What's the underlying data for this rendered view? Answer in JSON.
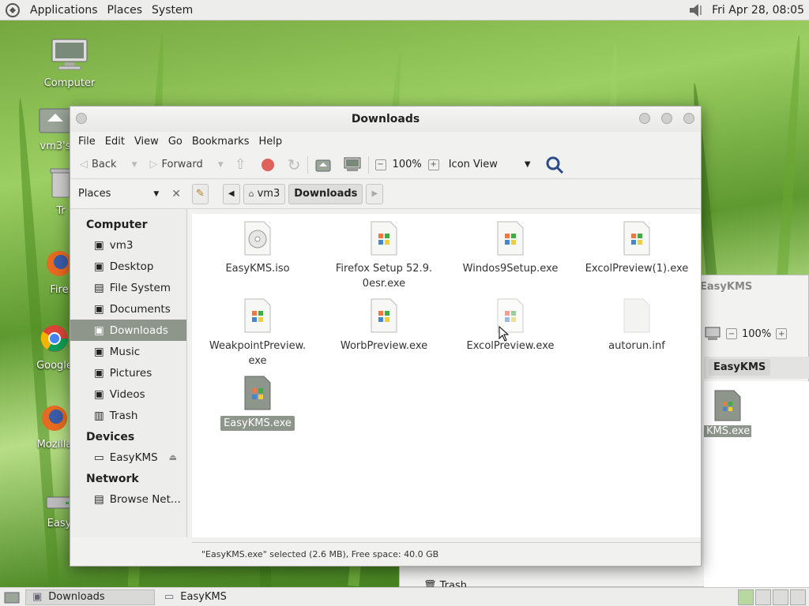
{
  "top_panel": {
    "menus": [
      "Applications",
      "Places",
      "System"
    ],
    "clock": "Fri Apr 28, 08:05"
  },
  "desktop_icons": [
    {
      "label": "Computer",
      "icon": "computer-icon"
    },
    {
      "label": "vm3's",
      "icon": "home-folder-icon"
    },
    {
      "label": "Tr",
      "icon": "trash-icon"
    },
    {
      "label": "Fire",
      "icon": "firefox-icon"
    },
    {
      "label": "Google",
      "icon": "chrome-icon"
    },
    {
      "label": "Mozilla",
      "icon": "firefox-icon"
    },
    {
      "label": "Easy",
      "icon": "drive-icon"
    }
  ],
  "window": {
    "title": "Downloads",
    "menus": [
      "File",
      "Edit",
      "View",
      "Go",
      "Bookmarks",
      "Help"
    ],
    "toolbar": {
      "back": "Back",
      "forward": "Forward",
      "zoom": "100%",
      "view_mode": "Icon View"
    },
    "places_label": "Places",
    "breadcrumbs": [
      "vm3",
      "Downloads"
    ],
    "sidebar": {
      "computer_header": "Computer",
      "computer_items": [
        "vm3",
        "Desktop",
        "File System",
        "Documents",
        "Downloads",
        "Music",
        "Pictures",
        "Videos",
        "Trash"
      ],
      "devices_header": "Devices",
      "devices_items": [
        "EasyKMS"
      ],
      "network_header": "Network",
      "network_items": [
        "Browse Net..."
      ]
    },
    "files": [
      {
        "name": "EasyKMS.iso",
        "type": "disc"
      },
      {
        "name": "Firefox Setup 52.9.",
        "name2": "0esr.exe",
        "type": "exe"
      },
      {
        "name": "Windos9Setup.exe",
        "type": "exe"
      },
      {
        "name": "ExcolPreview(1).exe",
        "type": "exe"
      },
      {
        "name": "WeakpointPreview.",
        "name2": "exe",
        "type": "exe"
      },
      {
        "name": "WorbPreview.exe",
        "type": "exe"
      },
      {
        "name": "ExcolPreview.exe",
        "type": "exe"
      },
      {
        "name": "autorun.inf",
        "type": "blank"
      },
      {
        "name": "EasyKMS.exe",
        "type": "exe",
        "selected": true
      }
    ],
    "status": "\"EasyKMS.exe\" selected (2.6 MB), Free space: 40.0 GB"
  },
  "bg_window": {
    "title": "EasyKMS",
    "zoom": "100%",
    "crumb": "EasyKMS",
    "file": "KMS.exe",
    "sidebar_item": "Trash"
  },
  "taskbar": {
    "tasks": [
      "Downloads",
      "EasyKMS"
    ]
  }
}
